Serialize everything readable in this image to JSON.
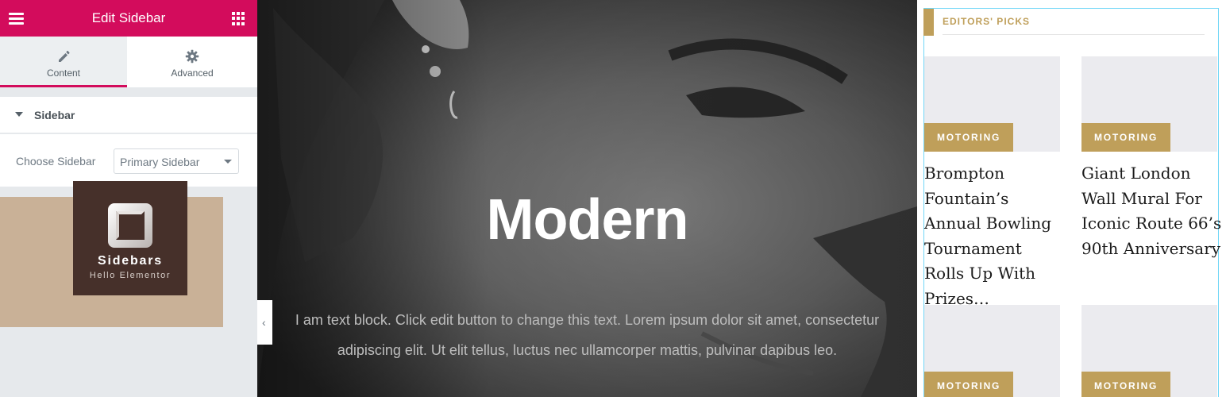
{
  "panel": {
    "title": "Edit Sidebar",
    "tabs": [
      {
        "label": "Content",
        "icon": "pencil-icon"
      },
      {
        "label": "Advanced",
        "icon": "gear-icon"
      }
    ],
    "section": {
      "title": "Sidebar"
    },
    "control": {
      "label": "Choose Sidebar",
      "value": "Primary Sidebar"
    },
    "promo": {
      "title": "Sidebars",
      "subtitle": "Hello Elementor"
    }
  },
  "hero": {
    "title": "Modern",
    "text": "I am text block. Click edit button to change this text. Lorem ipsum dolor sit amet, consectetur adipiscing elit. Ut elit tellus, luctus nec ullamcorper mattis, pulvinar dapibus leo."
  },
  "sidebar": {
    "heading": "EDITORS' PICKS",
    "posts": [
      {
        "category": "MOTORING",
        "title": "Brompton Fountain’s Annual Bowling Tournament Rolls Up With Prizes…"
      },
      {
        "category": "MOTORING",
        "title": "Giant London Wall Mural For Iconic Route 66’s 90th Anniversary"
      },
      {
        "category": "MOTORING",
        "title": ""
      },
      {
        "category": "MOTORING",
        "title": ""
      }
    ]
  },
  "colors": {
    "brand": "#d30c5c",
    "accent_gold": "#bf9f5a",
    "promo_bg": "#c9b197",
    "promo_card": "#46302a",
    "selection_outline": "#71d7f7"
  }
}
